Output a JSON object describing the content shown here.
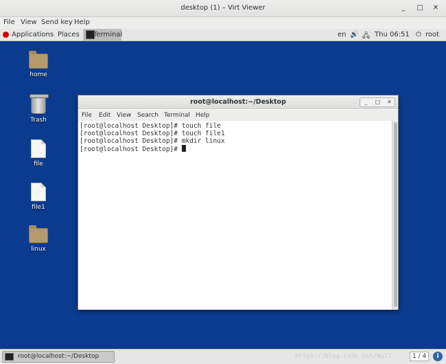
{
  "window": {
    "title": "desktop (1) – Virt Viewer",
    "min": "_",
    "max": "□",
    "close": "✕"
  },
  "menubar": [
    "File",
    "View",
    "Send key",
    "Help"
  ],
  "guest_panel": {
    "applications": "Applications",
    "places": "Places",
    "task": "Terminal",
    "lang": "en",
    "volume_icon": "🔊",
    "network_icon": "🖧",
    "clock": "Thu 06:51",
    "power_icon": "⏻",
    "user": "root"
  },
  "desktop_icons": [
    {
      "label": "home",
      "type": "folder",
      "inner": "⌂"
    },
    {
      "label": "Trash",
      "type": "trash"
    },
    {
      "label": "file",
      "type": "doc"
    },
    {
      "label": "file1",
      "type": "doc"
    },
    {
      "label": "linux",
      "type": "folder"
    }
  ],
  "terminal": {
    "title": "root@localhost:~/Desktop",
    "menus": [
      "File",
      "Edit",
      "View",
      "Search",
      "Terminal",
      "Help"
    ],
    "lines": [
      "[root@localhost Desktop]# touch file",
      "[root@localhost Desktop]# touch file1",
      "[root@localhost Desktop]# mkdir linux",
      "[root@localhost Desktop]# "
    ],
    "btn_min": "_",
    "btn_max": "□",
    "btn_close": "✕"
  },
  "bottom_panel": {
    "task": "root@localhost:~/Desktop",
    "workspace": "1 / 4",
    "info": "i",
    "watermark": "https://blog.csdn.net/mull"
  }
}
